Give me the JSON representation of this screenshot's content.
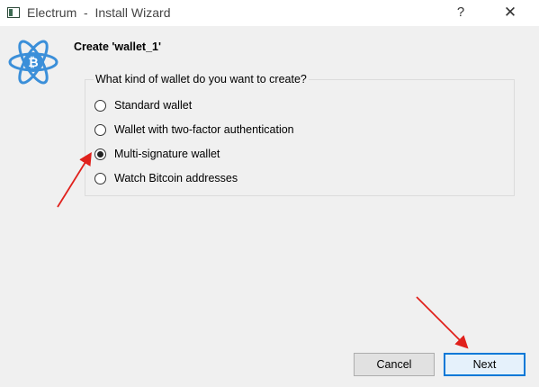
{
  "window": {
    "title": "Electrum  -  Install Wizard",
    "help_glyph": "?",
    "close_glyph": "✕"
  },
  "wizard": {
    "heading": "Create 'wallet_1'",
    "question": "What kind of wallet do you want to create?",
    "options": [
      {
        "label": "Standard wallet",
        "selected": false
      },
      {
        "label": "Wallet with two-factor authentication",
        "selected": false
      },
      {
        "label": "Multi-signature wallet",
        "selected": true
      },
      {
        "label": "Watch Bitcoin addresses",
        "selected": false
      }
    ]
  },
  "buttons": {
    "cancel": "Cancel",
    "next": "Next"
  },
  "colors": {
    "accent": "#0078d7",
    "logo_blue": "#3b8fd9",
    "annotation_red": "#e0211c"
  },
  "icons": {
    "app": "electrum-app-icon",
    "logo": "electrum-bitcoin-atom-logo"
  }
}
